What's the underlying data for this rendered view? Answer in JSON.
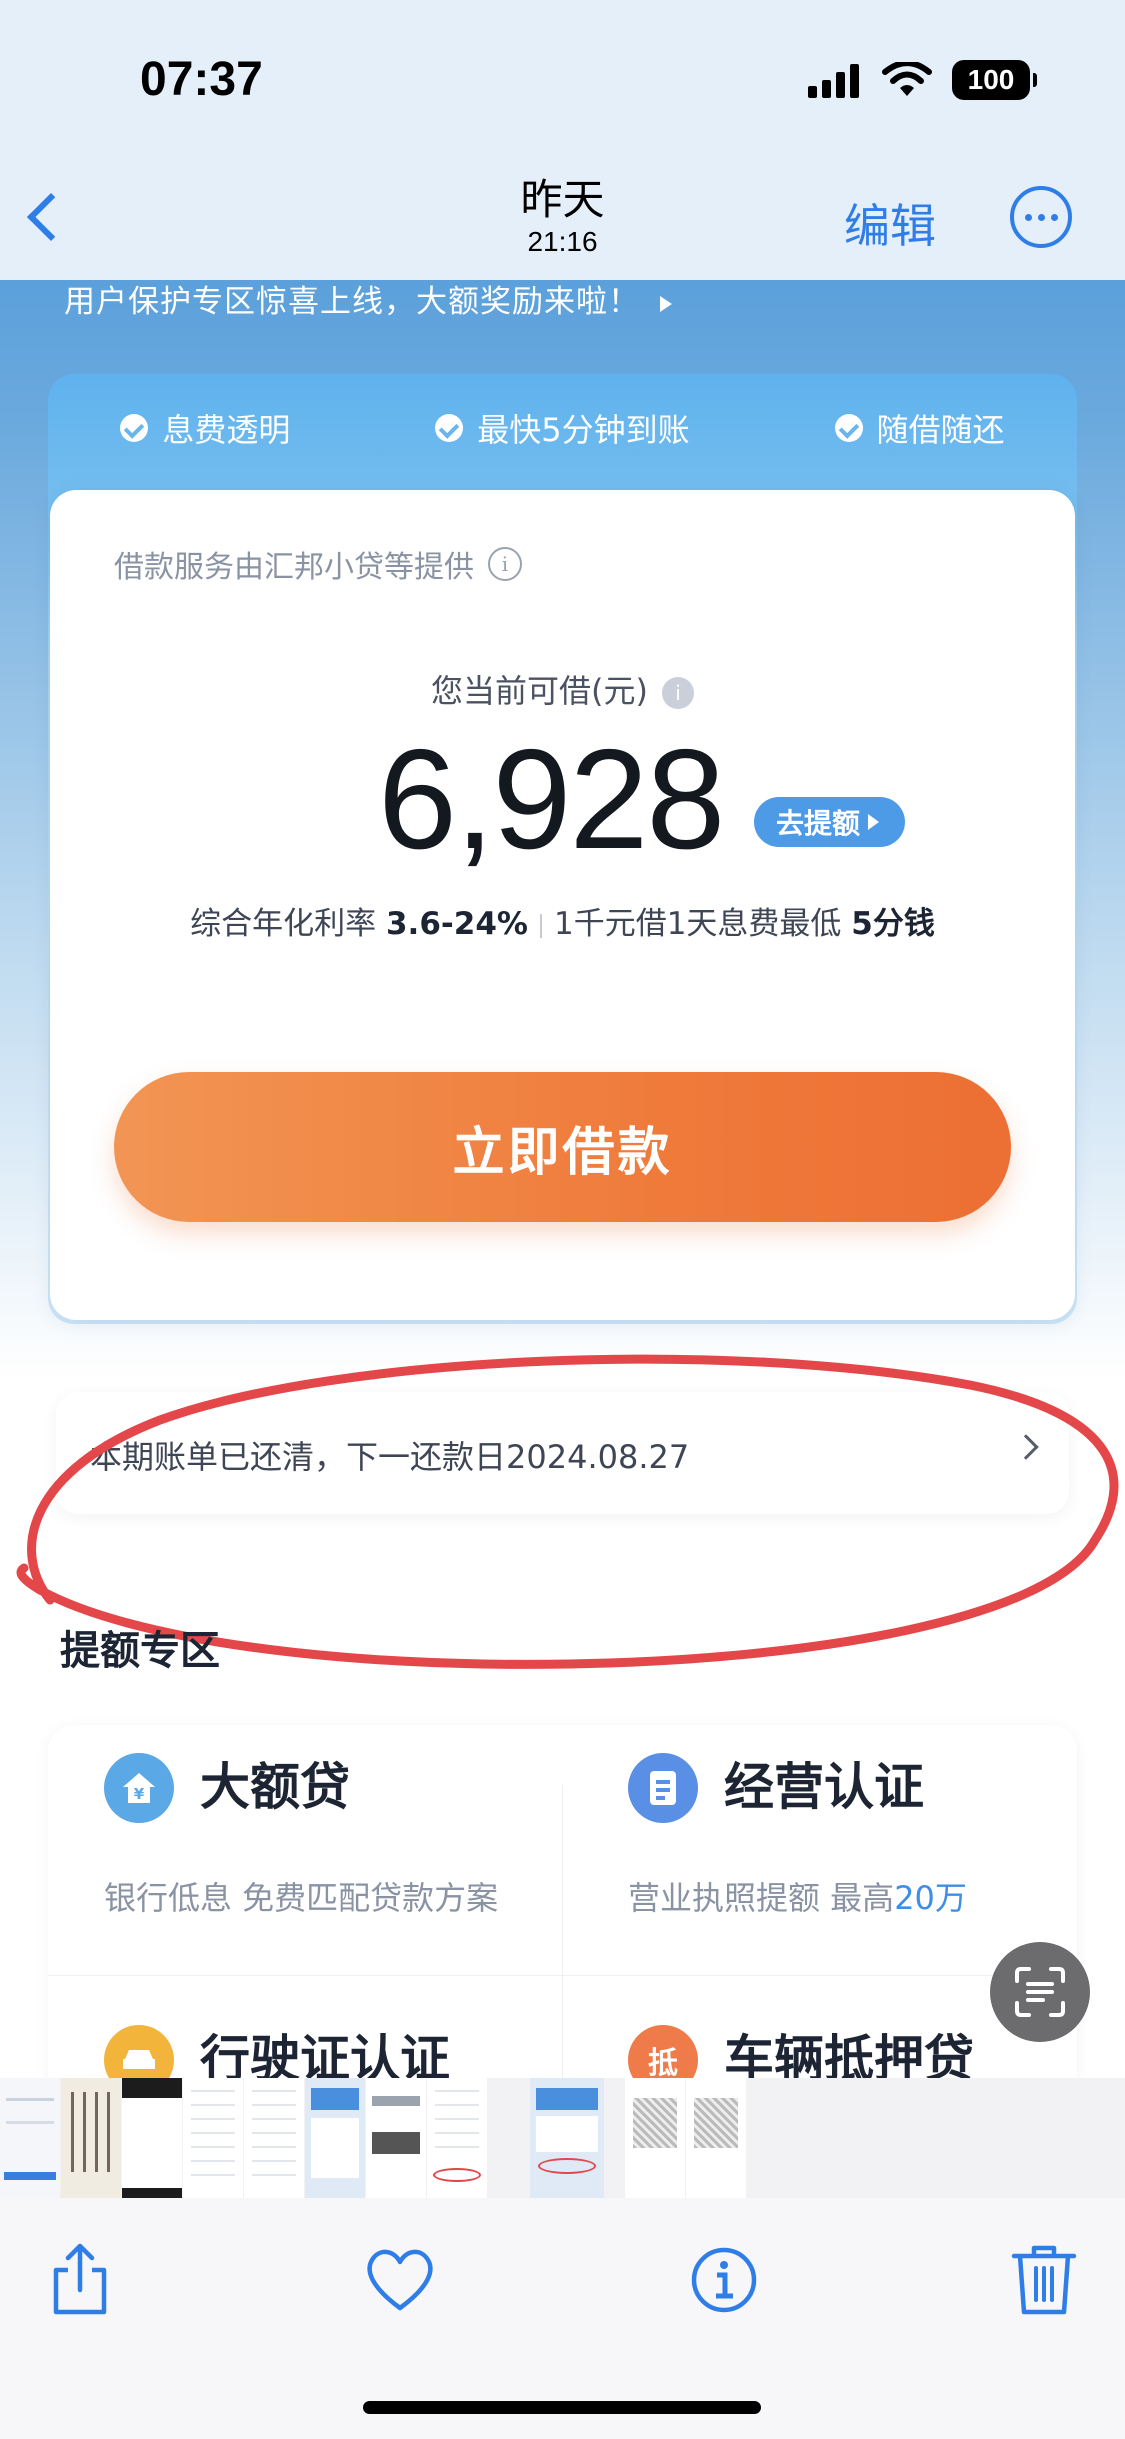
{
  "status_bar": {
    "time": "07:37",
    "battery": "100"
  },
  "photo_nav": {
    "title": "昨天",
    "subtitle": "21:16",
    "edit_label": "编辑"
  },
  "loan_app": {
    "banner": "用户保护专区惊喜上线，大额奖励来啦！",
    "features": [
      "息费透明",
      "最快5分钟到账",
      "随借随还"
    ],
    "provider": "借款服务由汇邦小贷等提供",
    "available_label": "您当前可借(元)",
    "amount": "6,928",
    "raise_button": "去提额",
    "rate_prefix": "综合年化利率",
    "rate_value": "3.6-24%",
    "fee_prefix": "1千元借1天息费最低",
    "fee_value": "5分钱",
    "borrow_button": "立即借款",
    "bill_status": "本期账单已还清，下一还款日2024.08.27",
    "section_title": "提额专区",
    "grid": [
      {
        "title": "大额贷",
        "subtitle": "银行低息 免费匹配贷款方案",
        "icon": "yuan-house-icon",
        "color": "#5aa8e6"
      },
      {
        "title": "经营认证",
        "subtitle_prefix": "营业执照提额 最高",
        "subtitle_highlight": "20万",
        "icon": "document-icon",
        "color": "#5a8fe6"
      },
      {
        "title": "行驶证认证",
        "icon": "car-icon",
        "color": "#f2b43a"
      },
      {
        "title": "车辆抵押贷",
        "icon": "mortgage-icon",
        "icon_text": "抵",
        "color": "#ef7b4a"
      }
    ]
  },
  "colors": {
    "accent_blue": "#2f7ee8",
    "borrow_orange": "#ef7b3b",
    "annotation_red": "#e4474a"
  }
}
